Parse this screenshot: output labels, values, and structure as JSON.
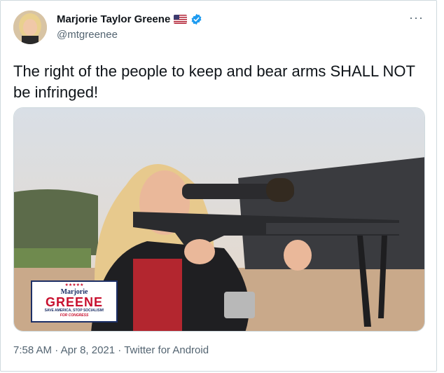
{
  "author": {
    "name": "Marjorie Taylor Greene",
    "handle": "@mtgreenee",
    "flag_icon": "us-flag-icon",
    "verified_icon": "verified-badge-icon"
  },
  "tweet": {
    "text": "The right of the people to keep and bear arms SHALL NOT be infringed!"
  },
  "media": {
    "logo": {
      "line1": "Marjorie",
      "line2": "GREENE",
      "line3": "SAVE AMERICA, STOP SOCIALISM!",
      "line4": "FOR CONGRESS"
    }
  },
  "meta": {
    "time": "7:58 AM",
    "sep1": " · ",
    "date": "Apr 8, 2021",
    "sep2": " · ",
    "source": "Twitter for Android"
  },
  "menu": {
    "more_label": "···"
  },
  "colors": {
    "verified": "#1d9bf0",
    "logo_red": "#c8102e",
    "logo_blue": "#1c2f66"
  }
}
